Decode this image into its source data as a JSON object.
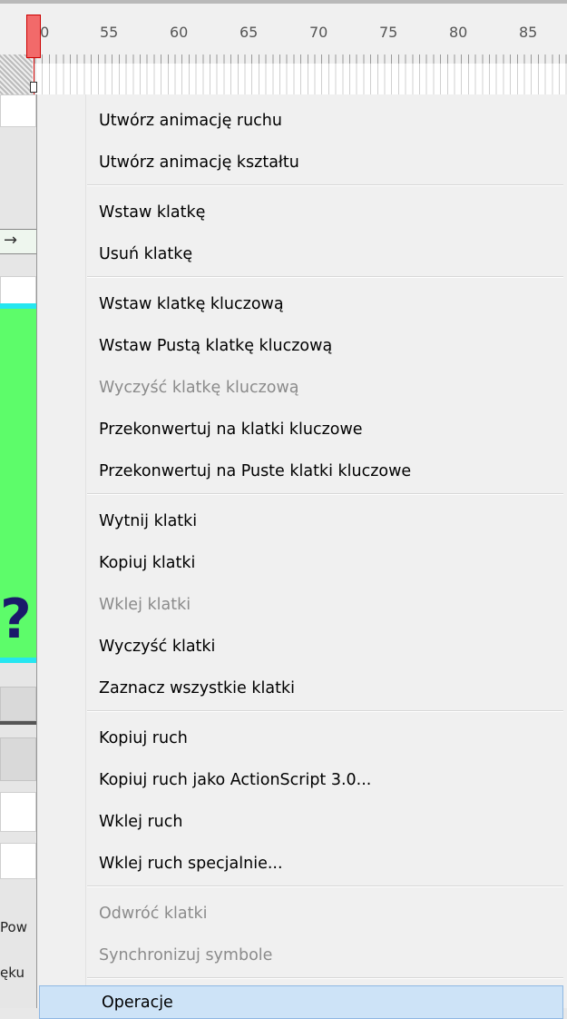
{
  "ruler": {
    "numbers": [
      "50",
      "55",
      "60",
      "65",
      "70",
      "75",
      "80",
      "85"
    ]
  },
  "side_panel": {
    "text_1": "Pow",
    "text_2": "ęku",
    "glyph": "?"
  },
  "menu": {
    "items": [
      {
        "label": "Utwórz animację ruchu",
        "enabled": true
      },
      {
        "label": "Utwórz animację kształtu",
        "enabled": true
      },
      {
        "label": "Wstaw klatkę",
        "enabled": true
      },
      {
        "label": "Usuń klatkę",
        "enabled": true
      },
      {
        "label": "Wstaw klatkę kluczową",
        "enabled": true
      },
      {
        "label": "Wstaw Pustą klatkę kluczową",
        "enabled": true
      },
      {
        "label": "Wyczyść klatkę kluczową",
        "enabled": false
      },
      {
        "label": "Przekonwertuj na klatki kluczowe",
        "enabled": true
      },
      {
        "label": "Przekonwertuj na Puste klatki kluczowe",
        "enabled": true
      },
      {
        "label": "Wytnij klatki",
        "enabled": true
      },
      {
        "label": "Kopiuj klatki",
        "enabled": true
      },
      {
        "label": "Wklej klatki",
        "enabled": false
      },
      {
        "label": "Wyczyść klatki",
        "enabled": true
      },
      {
        "label": "Zaznacz wszystkie klatki",
        "enabled": true
      },
      {
        "label": "Kopiuj ruch",
        "enabled": true
      },
      {
        "label": "Kopiuj ruch jako ActionScript 3.0...",
        "enabled": true
      },
      {
        "label": "Wklej ruch",
        "enabled": true
      },
      {
        "label": "Wklej ruch specjalnie...",
        "enabled": true
      },
      {
        "label": "Odwróć klatki",
        "enabled": false
      },
      {
        "label": "Synchronizuj symbole",
        "enabled": false
      },
      {
        "label": "Operacje",
        "enabled": true,
        "highlighted": true
      }
    ]
  },
  "colors": {
    "menu_bg": "#f0f0f0",
    "highlight": "#cde3f7",
    "disabled_text": "#8b8b8b",
    "playhead": "#f26a6a",
    "stage_green": "#5dfc6a",
    "stage_cyan": "#25e6f0"
  }
}
